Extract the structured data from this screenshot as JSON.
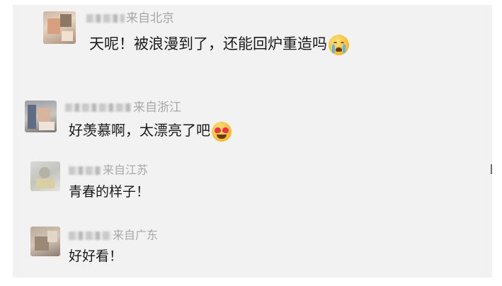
{
  "comments": [
    {
      "location": "来自北京",
      "text": "天呢！被浪漫到了，还能回炉重造吗",
      "emoji": "crying-face-emoji"
    },
    {
      "location": "来自浙江",
      "text": "好羡慕啊，太漂亮了吧",
      "emoji": "heart-eyes-emoji"
    },
    {
      "location": "来自江苏",
      "text": "青春的样子！",
      "emoji": ""
    },
    {
      "location": "来自广东",
      "text": "好好看！",
      "emoji": ""
    }
  ]
}
